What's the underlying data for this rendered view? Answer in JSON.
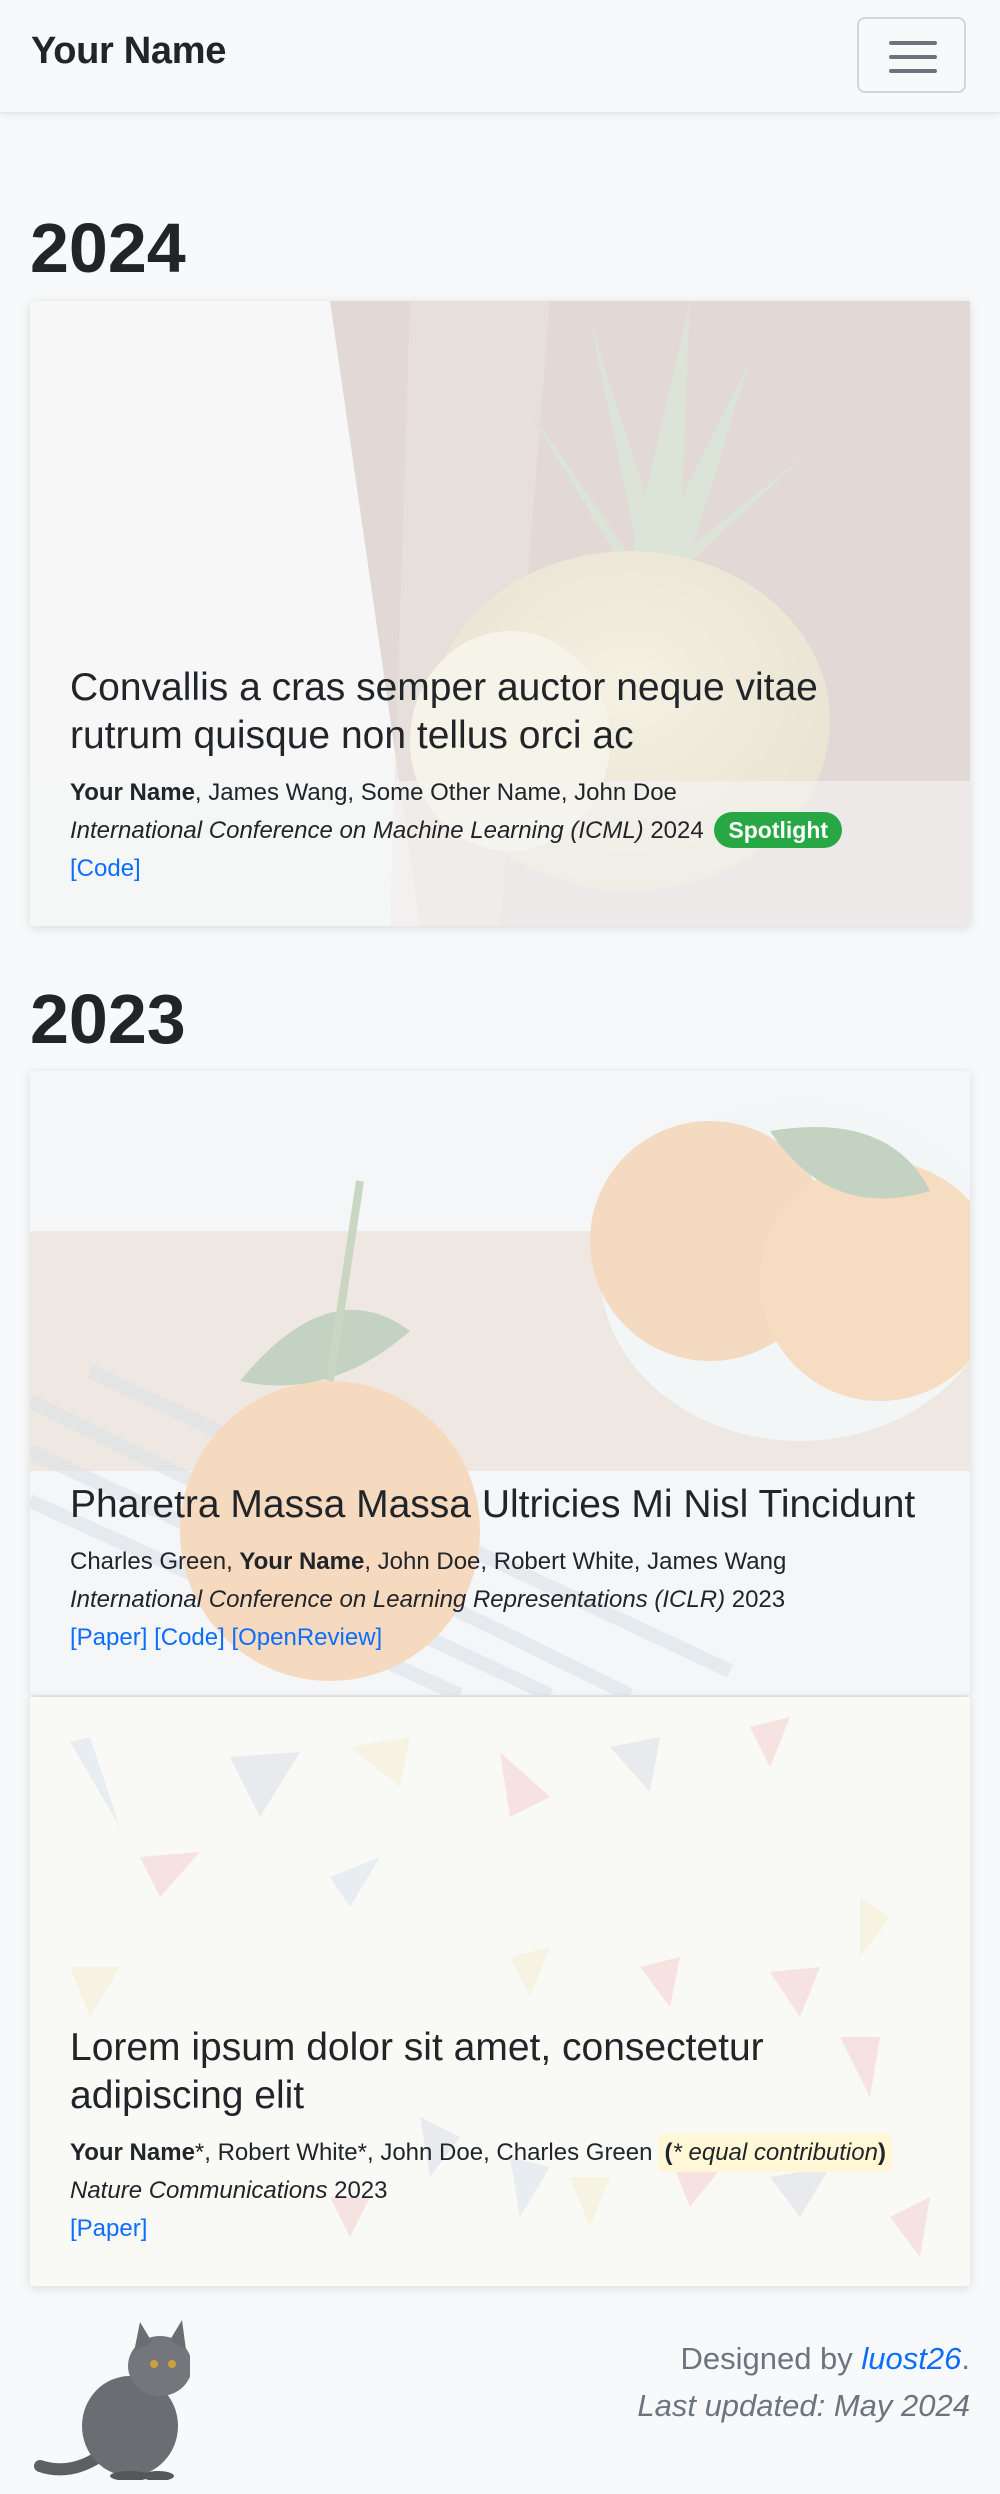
{
  "navbar": {
    "brand": "Your Name",
    "menu_icon": "hamburger-menu-icon"
  },
  "sections": [
    {
      "year": "2024",
      "papers": [
        {
          "title": "Convallis a cras semper auctor neque vitae rutrum quisque non tellus orci ac",
          "authors": {
            "first": "Your Name",
            "rest": ", James Wang, Some Other Name, John Doe"
          },
          "venue": {
            "name": "International Conference on Machine Learning (ICML)",
            "year": " 2024"
          },
          "badge": "Spotlight",
          "links": [
            "[Code]"
          ],
          "image": "pineapple"
        }
      ]
    },
    {
      "year": "2023",
      "papers": [
        {
          "title": "Pharetra Massa Massa Ultricies Mi Nisl Tincidunt",
          "authors": {
            "before": "Charles Green, ",
            "highlight": "Your Name",
            "after": ", John Doe, Robert White, James Wang"
          },
          "venue": {
            "name": "International Conference on Learning Representations (ICLR)",
            "year": " 2023"
          },
          "links": [
            "[Paper]",
            "[Code]",
            "[OpenReview]"
          ],
          "image": "oranges"
        },
        {
          "title": "Lorem ipsum dolor sit amet, consectetur adipiscing elit",
          "authors": {
            "first": "Your Name",
            "first_mark": "*",
            "rest": ", Robert White*, John Doe, Charles Green"
          },
          "equal_note": {
            "open": "(",
            "text": "* equal contribution",
            "close": ")"
          },
          "venue": {
            "name": "Nature Communications",
            "year": " 2023"
          },
          "links": [
            "[Paper]"
          ],
          "image": "confetti"
        }
      ]
    }
  ],
  "footer": {
    "designed_prefix": "Designed by ",
    "designer": "luost26",
    "period": ".",
    "updated": "Last updated: May 2024",
    "mascot": "cat-icon"
  },
  "colors": {
    "link": "#0d6efd",
    "badge": "#28a745",
    "background": "#f8f9fa",
    "text": "#212529",
    "muted": "#6c757d"
  }
}
